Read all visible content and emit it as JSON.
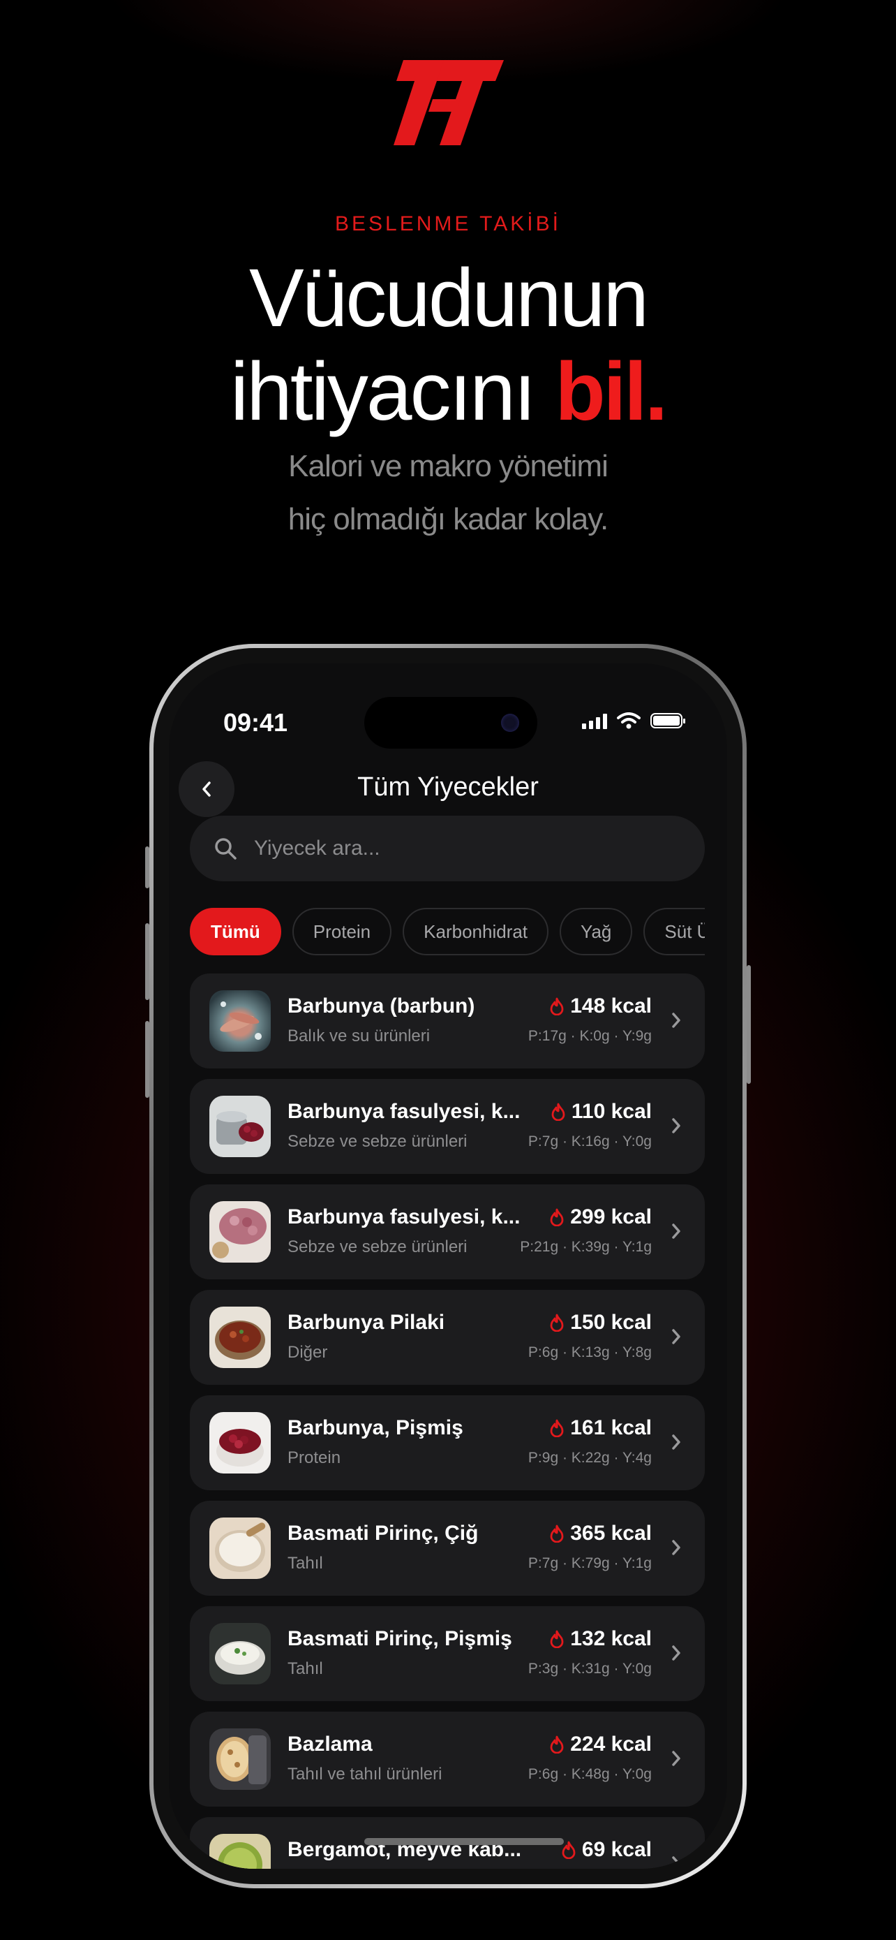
{
  "hero": {
    "eyebrow": "BESLENME TAKİBİ",
    "headline_line1": "Vücudunun",
    "headline_line2_prefix": "ihtiyacını ",
    "headline_accent": "bil.",
    "subtitle_line1": "Kalori ve makro yönetimi",
    "subtitle_line2": "hiç olmadığı kadar kolay.",
    "accent_color": "#e21b1b",
    "logo_icon": "brand-logo-icon"
  },
  "status_bar": {
    "time": "09:41",
    "icons": [
      "cellular-signal-icon",
      "wifi-icon",
      "battery-icon"
    ]
  },
  "screen": {
    "title": "Tüm Yiyecekler",
    "back_icon": "chevron-left-icon",
    "search": {
      "placeholder": "Yiyecek ara...",
      "value": "",
      "icon": "search-icon"
    },
    "chips": [
      {
        "label": "Tümü",
        "active": true
      },
      {
        "label": "Protein",
        "active": false
      },
      {
        "label": "Karbonhidrat",
        "active": false
      },
      {
        "label": "Yağ",
        "active": false
      },
      {
        "label": "Süt Ü",
        "active": false
      }
    ],
    "foods": [
      {
        "name": "Barbunya (barbun)",
        "category": "Balık ve su ürünleri",
        "kcal": "148 kcal",
        "macros": "P:17g · K:0g · Y:9g"
      },
      {
        "name": "Barbunya fasulyesi, k...",
        "category": "Sebze ve sebze ürünleri",
        "kcal": "110 kcal",
        "macros": "P:7g · K:16g · Y:0g"
      },
      {
        "name": "Barbunya fasulyesi, k...",
        "category": "Sebze ve sebze ürünleri",
        "kcal": "299 kcal",
        "macros": "P:21g · K:39g · Y:1g"
      },
      {
        "name": "Barbunya Pilaki",
        "category": "Diğer",
        "kcal": "150 kcal",
        "macros": "P:6g · K:13g · Y:8g"
      },
      {
        "name": "Barbunya, Pişmiş",
        "category": "Protein",
        "kcal": "161 kcal",
        "macros": "P:9g · K:22g · Y:4g"
      },
      {
        "name": "Basmati Pirinç, Çiğ",
        "category": "Tahıl",
        "kcal": "365 kcal",
        "macros": "P:7g · K:79g · Y:1g"
      },
      {
        "name": "Basmati Pirinç, Pişmiş",
        "category": "Tahıl",
        "kcal": "132 kcal",
        "macros": "P:3g · K:31g · Y:0g"
      },
      {
        "name": "Bazlama",
        "category": "Tahıl ve tahıl ürünleri",
        "kcal": "224 kcal",
        "macros": "P:6g · K:48g · Y:0g"
      },
      {
        "name": "Bergamot, meyve kab...",
        "category": "",
        "kcal": "69 kcal",
        "macros": ""
      }
    ],
    "kcal_icon": "flame-icon",
    "row_icon": "chevron-right-icon"
  }
}
